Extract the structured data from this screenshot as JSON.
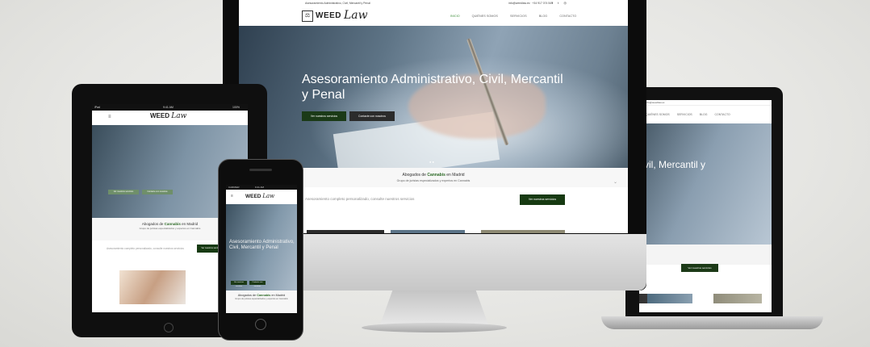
{
  "site": {
    "topbar": {
      "address": "Asesoramiento Administrativo, Civil, Mercantil y Penal",
      "contact": "info@weedlaw.es  ·  +34 917 074 549"
    },
    "logo": {
      "word": "WEED",
      "script": "Law",
      "mark": "⚖"
    },
    "nav": {
      "items": [
        "INICIO",
        "QUIÉNES SOMOS",
        "SERVICIOS",
        "BLOG",
        "CONTACTO"
      ],
      "active": "INICIO"
    },
    "hero": {
      "title": "Asesoramiento Administrativo, Civil, Mercantil y Penal",
      "primary_button": "Ver nuestros servicios",
      "secondary_button": "Contacte con nosotros",
      "dots": "● ●"
    },
    "intro": {
      "heading_prefix": "Abogados de",
      "heading_strong": "Cannabis",
      "heading_suffix": "en Madrid",
      "subheading": "Grupo de juristas especializados y expertos en Cannabis"
    },
    "cta": {
      "text": "Asesoramiento completo personalizado, consulte nuestros servicios",
      "button": "Ver nuestros servicios"
    }
  },
  "laptop": {
    "contact": "info@weedlaw.es",
    "nav_items": [
      "QUIÉNES SOMOS",
      "SERVICIOS",
      "BLOG",
      "CONTACTO"
    ],
    "hero_title": "vil, Mercantil y",
    "cta_button": "Ver nuestros servicios"
  },
  "tablet": {
    "status_left": "iPad",
    "status_time": "9:41 AM",
    "status_right": "100%",
    "menu_icon": "≡",
    "hero_button_1": "Ver nuestros servicios",
    "hero_button_2": "Contacte con nosotros",
    "cta_text": "Asesoramiento completo personalizado, consulte nuestros servicios",
    "cta_button": "Ver nuestros servicios"
  },
  "phone": {
    "status_left": "CARRIER",
    "status_time": "9:41 AM",
    "menu_icon": "≡",
    "hero_title": "Asesoramiento Administrativo, Civil, Mercantil y Penal",
    "hero_button_1": "Ver nuestros servicios",
    "hero_button_2": "Contacte con nosotros"
  },
  "social_icons": [
    "f",
    "t",
    "◎"
  ],
  "colors": {
    "brand_green": "#1b3a17",
    "nav_active": "#3e8e3a",
    "device_black": "#0c0c0c",
    "aluminum": "#c9c9c9"
  }
}
